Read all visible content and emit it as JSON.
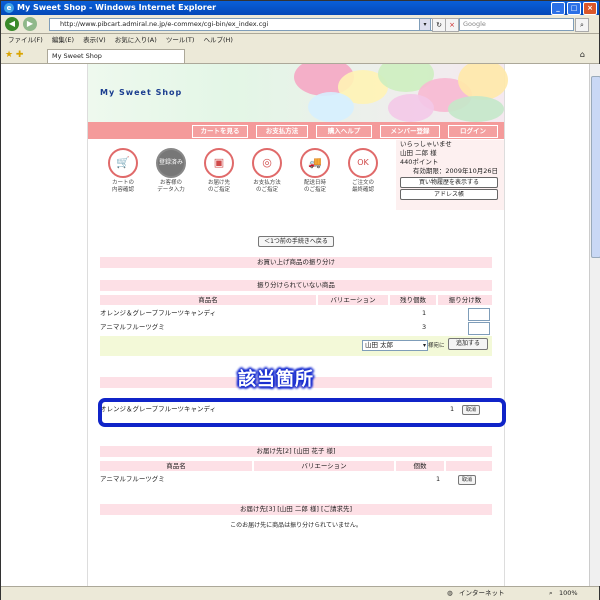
{
  "window": {
    "title": "My Sweet Shop - Windows Internet Explorer"
  },
  "address": {
    "url": "http://www.pibcart.admiral.ne.jp/e-commex/cgi-bin/ex_index.cgi",
    "search_placeholder": "Google"
  },
  "menu": [
    "ファイル(F)",
    "編集(E)",
    "表示(V)",
    "お気に入り(A)",
    "ツール(T)",
    "ヘルプ(H)"
  ],
  "tab": {
    "label": "My Sweet Shop"
  },
  "status": {
    "zone": "インターネット",
    "zoom": "100%"
  },
  "shop": {
    "name": "My Sweet Shop"
  },
  "nav": [
    "カートを見る",
    "お支払方法",
    "購入ヘルプ",
    "メンバー登録",
    "ログイン"
  ],
  "steps": [
    {
      "label1": "カートの",
      "label2": "内容確認",
      "icon": "cart-icon",
      "glyph": "🛒"
    },
    {
      "label1": "お客様の",
      "label2": "データ入力",
      "icon": "registered-icon",
      "glyph": "登録済み"
    },
    {
      "label1": "お届け先",
      "label2": "のご指定",
      "icon": "box-icon",
      "glyph": "▣"
    },
    {
      "label1": "お支払方法",
      "label2": "のご指定",
      "icon": "ring-icon",
      "glyph": "◎"
    },
    {
      "label1": "配送日時",
      "label2": "のご指定",
      "icon": "truck-icon",
      "glyph": "🚚"
    },
    {
      "label1": "ご注文の",
      "label2": "最終確認",
      "icon": "ok-icon",
      "glyph": "OK"
    }
  ],
  "user": {
    "greeting": "いらっしゃいませ",
    "name": "山田 二郎 様",
    "points": "440ポイント",
    "expiry": "有効期限：2009年10月26日",
    "history_btn": "買い物履歴を表示する",
    "address_btn": "アドレス帳"
  },
  "back_button": "＜1つ前の手続きへ戻る",
  "section_title": "お買い上げ商品の振り分け",
  "unassigned": {
    "title": "振り分けられていない商品",
    "headers": [
      "商品名",
      "バリエーション",
      "残り個数",
      "振り分け数"
    ],
    "rows": [
      {
        "name": "オレンジ＆グレープフルーツキャンディ",
        "qty": "1"
      },
      {
        "name": "アニマルフルーツグミ",
        "qty": "3"
      }
    ],
    "select_value": "山田 太郎",
    "select_suffix": "様宛に",
    "add_btn": "追加する"
  },
  "callout": "該当箇所",
  "highlighted_row": {
    "name": "オレンジ＆グレープフルーツキャンディ",
    "qty": "1",
    "btn": "取消"
  },
  "delivery2": {
    "title": "お届け先[2] [山田 花子 様]",
    "headers": [
      "商品名",
      "バリエーション",
      "個数"
    ],
    "rows": [
      {
        "name": "アニマルフルーツグミ",
        "qty": "1",
        "btn": "取消"
      }
    ]
  },
  "delivery3": {
    "title": "お届け先[3] [山田 二郎 様] [ご請求先]",
    "note": "このお届け先に商品は振り分けられていません。"
  }
}
